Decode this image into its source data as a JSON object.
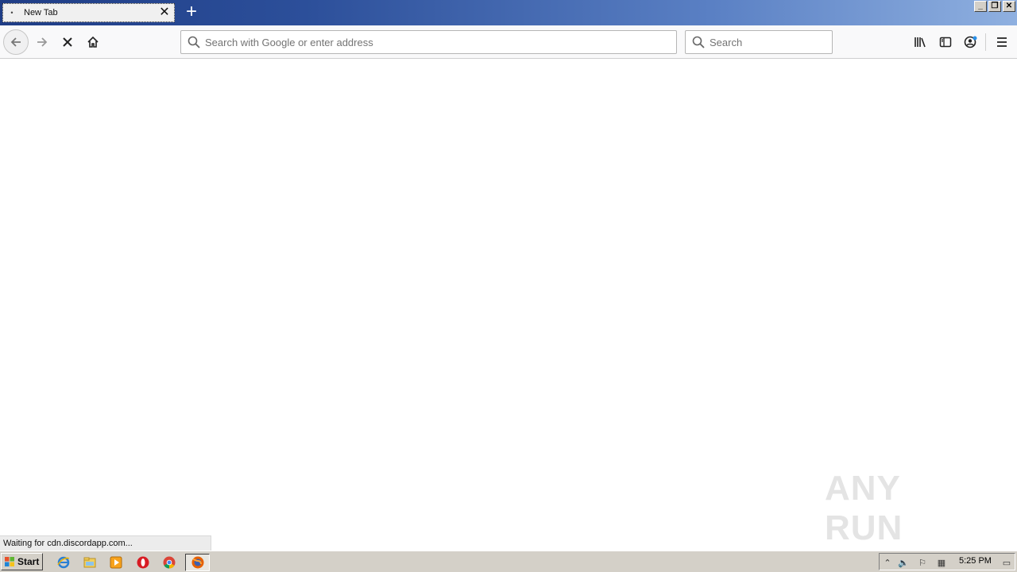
{
  "tab": {
    "title": "New Tab",
    "favicon": "dot-icon",
    "close": "✕"
  },
  "titlebar": {
    "new_tab": "+",
    "minimize": "_",
    "restore": "❐",
    "close": "✕"
  },
  "navbar": {
    "back": "back-arrow-icon",
    "forward": "forward-arrow-icon",
    "stop": "stop-icon",
    "home": "home-icon",
    "url_placeholder": "Search with Google or enter address",
    "search_placeholder": "Search",
    "library": "library-icon",
    "sidebar": "sidebar-icon",
    "account": "account-icon",
    "menu": "hamburger-menu-icon"
  },
  "status": {
    "text": "Waiting for cdn.discordapp.com..."
  },
  "watermark": {
    "text": "ANY RUN"
  },
  "taskbar": {
    "start_label": "Start",
    "clock": "5:25 PM",
    "pinned": [
      "ie-icon",
      "explorer-icon",
      "media-player-icon",
      "opera-icon",
      "chrome-icon",
      "firefox-icon"
    ]
  },
  "colors": {
    "titlebar_start": "#1f3d86",
    "titlebar_end": "#8fb0e0",
    "toolbar_bg": "#f9f9fa",
    "taskbar_bg": "#d4d0c8"
  }
}
